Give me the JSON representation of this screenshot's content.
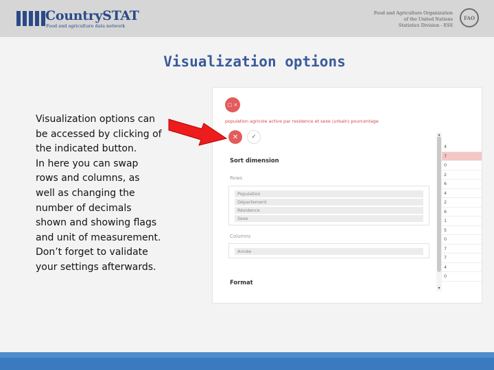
{
  "header": {
    "logo_title": "CountrySTAT",
    "logo_subtitle": "Food and agriculture data network",
    "fao_lines": [
      "Food and Agriculture Organization",
      "of the United Nations",
      "Statistics Division - ESS"
    ],
    "fao_emblem_text": "FAO"
  },
  "slide": {
    "title": "Visualization options",
    "body_lines": [
      "Visualization options can",
      "be accessed by clicking of",
      "the indicated button.",
      "In here you can swap",
      "rows and columns, as",
      "well as changing the",
      "number of decimals",
      "shown and showing flags",
      "and unit of measurement.",
      "Don’t forget to validate",
      "your settings afterwards."
    ]
  },
  "panel": {
    "close_icon": "close-icon",
    "title": "population agricole active par residence et sexe (urbain) pourcentage",
    "sort_label": "Sort dimension",
    "rows_label": "Rows",
    "rows_items": [
      "Population",
      "Département",
      "Résidence",
      "Sexe"
    ],
    "columns_label": "Columns",
    "columns_items": [
      "Année"
    ],
    "format_label": "Format",
    "right_column_values": [
      "4",
      "7",
      "0",
      "2",
      "6",
      "4",
      "2",
      "6",
      "1",
      "5",
      "0",
      "7",
      "7",
      "4",
      "0"
    ],
    "accent_color": "#e35b5b"
  },
  "colors": {
    "title_blue": "#3a5a9a",
    "brand_navy": "#2a4a87",
    "footer_blue": "#3a7abf",
    "arrow_red": "#ee1c1c"
  }
}
